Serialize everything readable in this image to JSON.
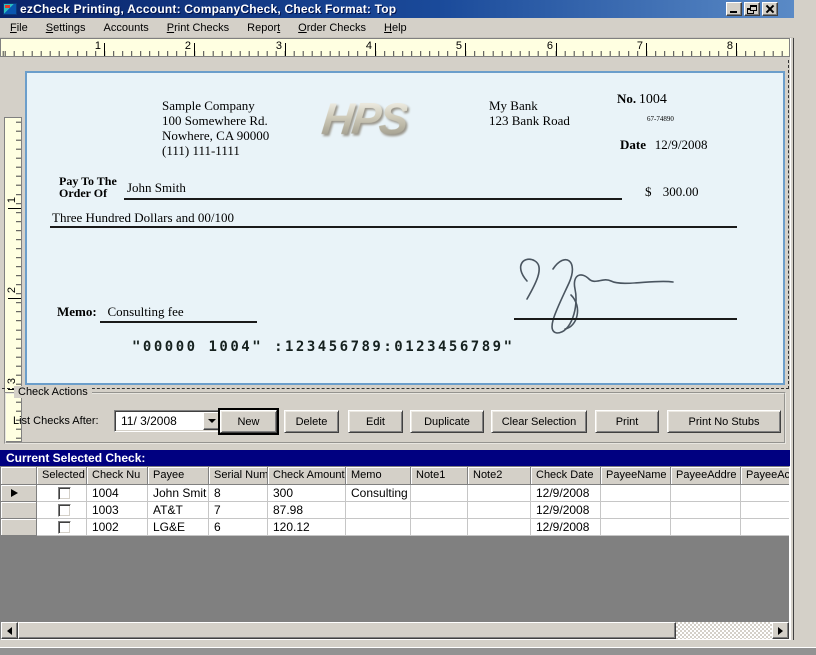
{
  "window": {
    "title": "ezCheck Printing, Account: CompanyCheck, Check Format: Top"
  },
  "menu": {
    "items": [
      {
        "pre": "",
        "key": "F",
        "post": "ile"
      },
      {
        "pre": "",
        "key": "S",
        "post": "ettings"
      },
      {
        "pre": "Accounts",
        "key": "",
        "post": ""
      },
      {
        "pre": "",
        "key": "P",
        "post": "rint Checks"
      },
      {
        "pre": "Repor",
        "key": "t",
        "post": ""
      },
      {
        "pre": "",
        "key": "O",
        "post": "rder Checks"
      },
      {
        "pre": "",
        "key": "H",
        "post": "elp"
      }
    ]
  },
  "ruler": {
    "h_labels": [
      "1",
      "2",
      "3",
      "4",
      "5",
      "6",
      "7",
      "8"
    ],
    "v_labels": [
      "1",
      "2",
      "3"
    ]
  },
  "check": {
    "company_line1": "Sample Company",
    "company_line2": "100 Somewhere Rd.",
    "company_line3": "Nowhere, CA 90000",
    "company_line4": "(111) 111-1111",
    "logo": "HPS",
    "bank_line1": "My Bank",
    "bank_line2": "123 Bank Road",
    "no_label": "No.",
    "no_value": "1004",
    "fraction": "67-74890",
    "date_label": "Date",
    "date_value": "12/9/2008",
    "payto_line1": "Pay To The",
    "payto_line2": "Order Of",
    "payee": "John Smith",
    "dollar_sign": "$",
    "amount": "300.00",
    "amount_words": "Three Hundred  Dollars and 00/100",
    "memo_label": "Memo:",
    "memo_value": "Consulting fee",
    "micr": "\"00000 1004\" :123456789:0123456789\""
  },
  "actions": {
    "legend": "Check Actions",
    "list_label": "List Checks After:",
    "date_value": "11/ 3/2008",
    "buttons": {
      "new": "New",
      "delete": "Delete",
      "edit": "Edit",
      "duplicate": "Duplicate",
      "clear_selection": "Clear Selection",
      "print": "Print",
      "print_no_stubs": "Print No Stubs"
    }
  },
  "grid": {
    "caption": "Current Selected Check:",
    "columns": [
      "Selected",
      "Check Nu",
      "Payee",
      "Serial Num",
      "Check Amount",
      "Memo",
      "Note1",
      "Note2",
      "Check Date",
      "PayeeName",
      "PayeeAddre",
      "PayeeAc"
    ],
    "rows": [
      {
        "current": true,
        "selected": false,
        "cells": [
          "1004",
          "John Smit",
          "8",
          "300",
          "Consulting",
          "",
          "",
          "12/9/2008",
          "",
          "",
          ""
        ]
      },
      {
        "current": false,
        "selected": false,
        "cells": [
          "1003",
          "AT&T",
          "7",
          "87.98",
          "",
          "",
          "",
          "12/9/2008",
          "",
          "",
          ""
        ]
      },
      {
        "current": false,
        "selected": false,
        "cells": [
          "1002",
          "LG&E",
          "6",
          "120.12",
          "",
          "",
          "",
          "12/9/2008",
          "",
          "",
          ""
        ]
      }
    ]
  },
  "colors": {
    "titlebar_start": "#0a246a",
    "titlebar_end": "#5a8ac6",
    "ruler_bg": "#ffffe1",
    "check_bg": "#e9f3f8",
    "check_border": "#6b9ecb",
    "caption_bg": "#000080",
    "window_bg": "#d4d0c8",
    "grid_empty_bg": "#808080"
  }
}
